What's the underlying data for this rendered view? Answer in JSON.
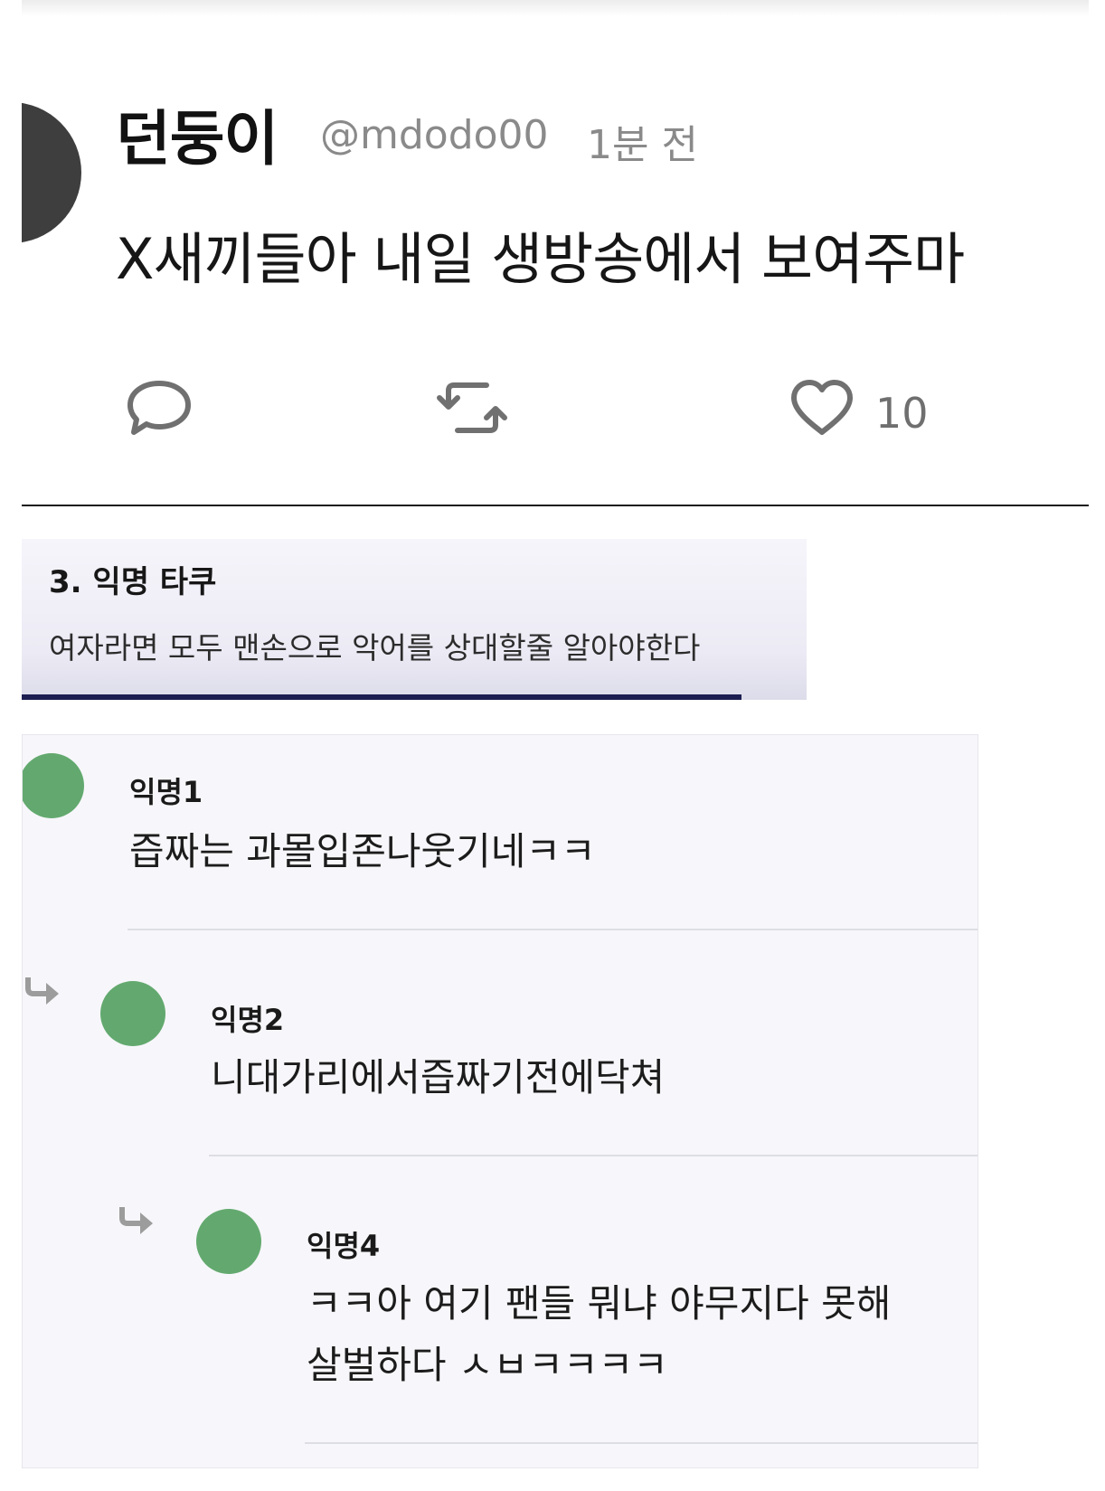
{
  "tweet": {
    "display_name": "던둥이",
    "handle": "@mdodo00",
    "time": "1분 전",
    "text": "X새끼들아 내일 생방송에서 보여주마",
    "like_count": "10",
    "icons": [
      "comment-icon",
      "retweet-icon",
      "heart-icon"
    ]
  },
  "banner": {
    "title": "3. 익명 타쿠",
    "subtitle": "여자라면 모두 맨손으로 악어를 상대할줄 알아야한다"
  },
  "comments": [
    {
      "name": "익명1",
      "text": "즙짜는 과몰입존나웃기네ㅋㅋ"
    },
    {
      "name": "익명2",
      "text": "니대가리에서즙짜기전에닥쳐"
    },
    {
      "name": "익명4",
      "text_line1": "ㅋㅋ아 여기 팬들 뭐냐 야무지다 못해",
      "text_line2": "살벌하다 ㅅㅂㅋㅋㅋㅋ"
    }
  ],
  "colors": {
    "avatar_green": "#63a96f",
    "tweet_avatar": "#3e3e3e",
    "banner_bar": "#1d1f52"
  }
}
